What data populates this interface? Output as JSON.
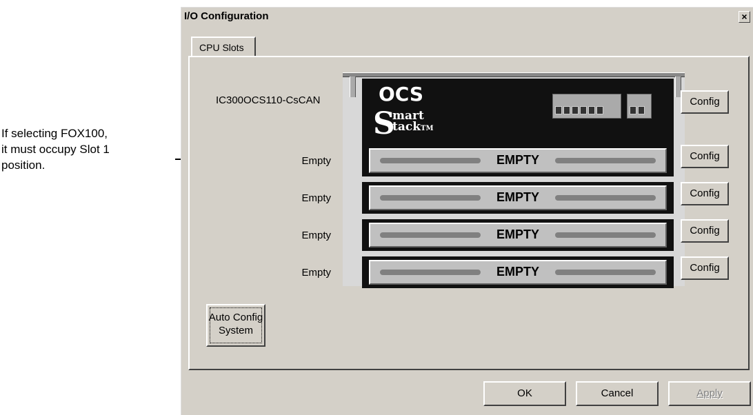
{
  "annotation": {
    "lines": [
      "If selecting FOX100,",
      "it must occupy Slot 1",
      "position."
    ]
  },
  "dialog": {
    "title": "I/O Configuration",
    "close_label": "×",
    "tab_label": "CPU Slots",
    "cpu_label": "IC300OCS110-CsCAN",
    "cpu_module": {
      "logo_ocs": "OCS",
      "logo_s": "S",
      "logo_mart": "mart",
      "logo_tack": "tack",
      "logo_tm": "TM"
    },
    "slots": [
      {
        "label": "Empty",
        "module_text": "EMPTY"
      },
      {
        "label": "Empty",
        "module_text": "EMPTY"
      },
      {
        "label": "Empty",
        "module_text": "EMPTY"
      },
      {
        "label": "Empty",
        "module_text": "EMPTY"
      }
    ],
    "config_label": "Config",
    "auto_config_line1": "Auto Config",
    "auto_config_line2": "System",
    "ok_label": "OK",
    "cancel_label": "Cancel",
    "apply_label": "Apply"
  }
}
